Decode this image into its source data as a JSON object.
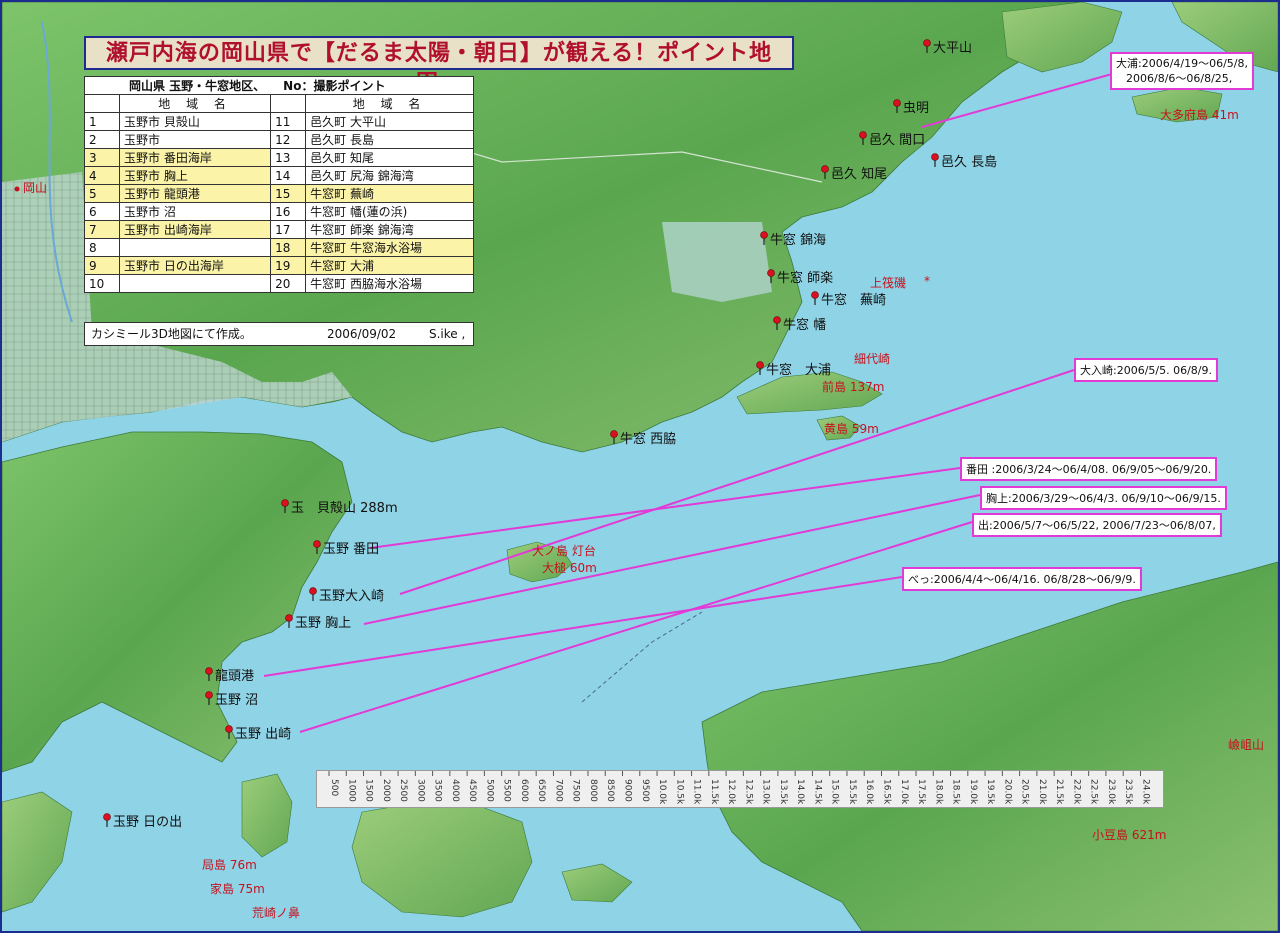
{
  "title": "瀬戸内海の岡山県で【だるま太陽・朝日】が観える！ポイント地図。",
  "table": {
    "caption": "岡山県 玉野・牛窓地区、　　No：撮影ポイント",
    "column_header": "地 域 名",
    "left": [
      {
        "no": "1",
        "name": "玉野市 貝殻山",
        "highlight": false
      },
      {
        "no": "2",
        "name": "玉野市",
        "highlight": false
      },
      {
        "no": "3",
        "name": "玉野市 番田海岸",
        "highlight": true
      },
      {
        "no": "4",
        "name": "玉野市 胸上",
        "highlight": true
      },
      {
        "no": "5",
        "name": "玉野市 龍頭港",
        "highlight": true
      },
      {
        "no": "6",
        "name": "玉野市 沼",
        "highlight": false
      },
      {
        "no": "7",
        "name": "玉野市 出崎海岸",
        "highlight": true
      },
      {
        "no": "8",
        "name": "",
        "highlight": false
      },
      {
        "no": "9",
        "name": "玉野市 日の出海岸",
        "highlight": true
      },
      {
        "no": "10",
        "name": "",
        "highlight": false
      }
    ],
    "right": [
      {
        "no": "11",
        "name": "邑久町 大平山",
        "highlight": false
      },
      {
        "no": "12",
        "name": "邑久町 長島",
        "highlight": false
      },
      {
        "no": "13",
        "name": "邑久町 知尾",
        "highlight": false
      },
      {
        "no": "14",
        "name": "邑久町 尻海 錦海湾",
        "highlight": false
      },
      {
        "no": "15",
        "name": "牛窓町 蕪崎",
        "highlight": true
      },
      {
        "no": "16",
        "name": "牛窓町 幡(蓮の浜)",
        "highlight": false
      },
      {
        "no": "17",
        "name": "牛窓町 師楽 錦海湾",
        "highlight": false
      },
      {
        "no": "18",
        "name": "牛窓町 牛窓海水浴場",
        "highlight": true
      },
      {
        "no": "19",
        "name": "牛窓町 大浦",
        "highlight": true
      },
      {
        "no": "20",
        "name": "牛窓町 西脇海水浴場",
        "highlight": false
      }
    ]
  },
  "credit": {
    "text": "カシミール3D地図にて作成。",
    "date": "2006/09/02",
    "author": "S.ike ,"
  },
  "callouts": {
    "oura": {
      "line1": "大浦:2006/4/19～06/5/8,",
      "line2": "2006/8/6～06/8/25,"
    },
    "ooirizaki": "大入崎:2006/5/5. 06/8/9.",
    "banda": "番田 :2006/3/24～06/4/08. 06/9/05～06/9/20.",
    "muneage": "胸上:2006/3/29～06/4/3. 06/9/10～06/9/15.",
    "dezaki": "出:2006/5/7～06/5/22, 2006/7/23～06/8/07,",
    "beppu": "べっ:2006/4/4～06/4/16. 06/8/28～06/9/9."
  },
  "pins": {
    "ohirayama": "大平山",
    "mushiake": "虫明",
    "oku_maguchi": "邑久 間口",
    "oku_nagashima": "邑久 長島",
    "oku_chio": "邑久 知尾",
    "ushimado_kinkai": "牛窓 錦海",
    "ushimado_shiraku": "牛窓 師楽",
    "ushimado_kaburazaki": "牛窓　蕪崎",
    "ushimado_hata": "牛窓 幡",
    "ushimado_oura": "牛窓　大浦",
    "ushimado_nishiwaki": "牛窓 西脇",
    "tamano_kaigarayama": "玉　貝殻山 288m",
    "tamano_banda": "玉野 番田",
    "tamano_ooirizaki": "玉野大入崎",
    "tamano_muneage": "玉野 胸上",
    "ryuzuko": "龍頭港",
    "tamano_numa": "玉野 沼",
    "tamano_dezaki": "玉野 出崎",
    "tamano_hinode": "玉野 日の出",
    "okayama": "岡山"
  },
  "red_labels": {
    "ootabujima": "大多府島 41m",
    "kamifunaiso": "上筏磯",
    "kashirodaizaki": "細代崎",
    "maejima": "前島 137m",
    "kuroshima": "黄島 59m",
    "oozuchi_todai": "大ノ島 灯台",
    "oozuchi": "大槌 60m",
    "kashima": "局島 76m",
    "ieshima": "家島 75m",
    "arasakinohana": "荒崎ノ鼻",
    "dounzan": "嶮岨山",
    "shodoshima": "小豆島 621m",
    "asterisk": "*"
  },
  "scale": {
    "ticks": [
      "500",
      "1000",
      "1500",
      "2000",
      "2500",
      "3000",
      "3500",
      "4000",
      "4500",
      "5000",
      "5500",
      "6000",
      "6500",
      "7000",
      "7500",
      "8000",
      "8500",
      "9000",
      "9500",
      "10.0k",
      "10.5k",
      "11.0k",
      "11.5k",
      "12.0k",
      "12.5k",
      "13.0k",
      "13.5k",
      "14.0k",
      "14.5k",
      "15.0k",
      "15.5k",
      "16.0k",
      "16.5k",
      "17.0k",
      "17.5k",
      "18.0k",
      "18.5k",
      "19.0k",
      "19.5k",
      "20.0k",
      "20.5k",
      "21.0k",
      "21.5k",
      "22.0k",
      "22.5k",
      "23.0k",
      "23.5k",
      "24.0k"
    ]
  },
  "colors": {
    "sea": "#8fd3e6",
    "land": "#5fae52",
    "callout_border": "#e23ad6",
    "title_text": "#b0102d",
    "highlight": "#fbf3a7"
  }
}
